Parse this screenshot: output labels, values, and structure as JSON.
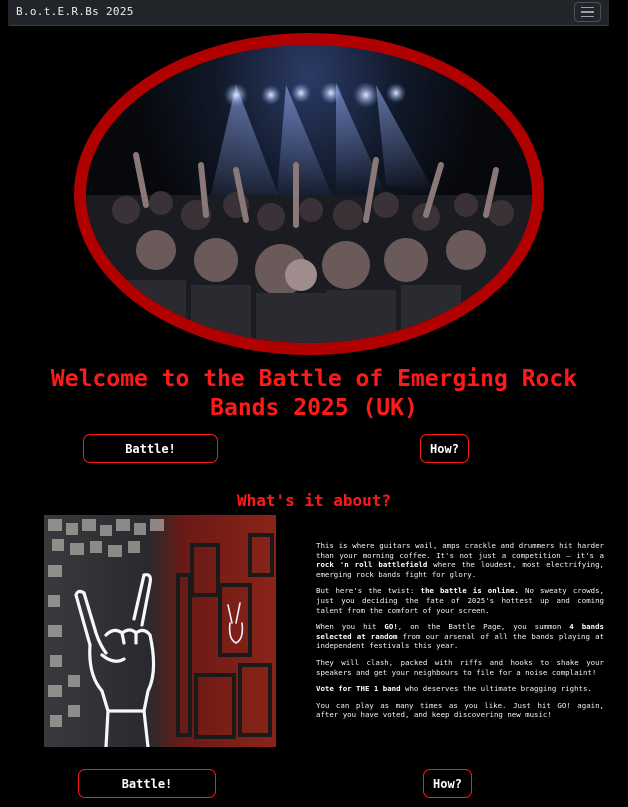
{
  "navbar": {
    "brand": "B.o.t.E.R.Bs 2025",
    "toggler_icon": "hamburger-icon"
  },
  "hero": {
    "image_alt": "crowd-photo",
    "border_color": "#b00000"
  },
  "title": "Welcome to the Battle of Emerging Rock Bands 2025 (UK)",
  "buttons": {
    "battle": "Battle!",
    "how": "How?"
  },
  "about": {
    "heading": "What's it about?",
    "image_alt": "neon-rock-hand",
    "p1": {
      "a": "This is where guitars wail, amps crackle and drummers hit harder than your morning coffee. It's not just a competition – it's a ",
      "b": "rock 'n roll battlefield",
      "c": " where the loudest, most electrifying, emerging rock bands fight for glory."
    },
    "p2": {
      "a": "But here's the twist: ",
      "b": "the battle is online.",
      "c": " No sweaty crowds, just you deciding the fate of 2025's hottest up and coming talent from the comfort of your screen."
    },
    "p3": {
      "a": "When you hit ",
      "b": "GO!",
      "c": ", on the Battle Page, you summon ",
      "d": "4 bands selected at random",
      "e": " from our arsenal of all the bands playing at independent festivals this year."
    },
    "p4": "They will clash, packed with riffs and hooks to shake your speakers and get your neighbours to file for a noise complaint!",
    "p5": {
      "a": "Vote for THE 1 band",
      "b": " who deserves the ultimate bragging rights."
    },
    "p6": "You can play as many times as you like. Just hit GO! again, after you have voted, and keep discovering new music!"
  },
  "colors": {
    "accent": "#ff1a1a",
    "background": "#000000",
    "navbar": "#212529"
  }
}
